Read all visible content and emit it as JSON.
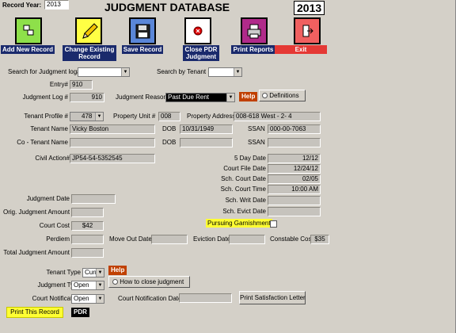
{
  "header": {
    "record_year_label": "Record Year:",
    "record_year_value": "2013",
    "title": "JUDGMENT DATABASE",
    "year_badge": "2013"
  },
  "toolbar": {
    "add_new_record": "Add New Record",
    "change_existing_record": "Change Existing Record",
    "save_record": "Save Record",
    "close_pdr_judgment": "Close PDR Judgment",
    "print_reports": "Print Reports",
    "exit": "Exit"
  },
  "search": {
    "judgment_log_label": "Search for Judgment log#",
    "judgment_log_value": "",
    "tenant_label": "Search by Tenant",
    "tenant_value": ""
  },
  "record": {
    "entry_label": "Entry#",
    "entry_value": "910",
    "judgment_log_label": "Judgment Log #",
    "judgment_log_value": "910",
    "judgment_reason_label": "Judgment Reason",
    "judgment_reason_value": "Past Due Rent",
    "help_label": "Help",
    "definitions_label": "Definitions",
    "tenant_profile_label": "Tenant Profile #",
    "tenant_profile_value": "478",
    "property_unit_label": "Property  Unit #",
    "property_unit_value": "008",
    "property_address_label": "Property  Address:",
    "property_address_value": "008-618 West  - 2- 4",
    "tenant_name_label": "Tenant Name",
    "tenant_name_value": "Vicky Boston",
    "dob_label": "DOB",
    "dob_value": "10/31/1949",
    "ssan_label": "SSAN",
    "ssan_value": "000-00-7063",
    "co_tenant_name_label": "Co - Tenant Name",
    "co_tenant_name_value": "",
    "co_dob_label": "DOB",
    "co_dob_value": "",
    "co_ssan_label": "SSAN",
    "co_ssan_value": "",
    "civil_action_label": "Civil Action#",
    "civil_action_value": "JP54-54-5352545"
  },
  "dates": {
    "five_day_label": "5 Day Date",
    "five_day_value": "12/12",
    "court_file_label": "Court File Date",
    "court_file_value": "12/24/12",
    "sch_court_date_label": "Sch. Court Date",
    "sch_court_date_value": "02/05",
    "sch_court_time_label": "Sch. Court Time",
    "sch_court_time_value": "10:00 AM",
    "sch_writ_label": "Sch. Writ Date",
    "sch_writ_value": "",
    "sch_evict_label": "Sch. Evict Date",
    "sch_evict_value": "",
    "pursuing_garnishment_label": "Pursuing Garnishment"
  },
  "amounts": {
    "judgment_date_label": "Judgment Date",
    "judgment_date_value": "",
    "orig_judgment_amount_label": "Orig. Judgment Amount",
    "orig_judgment_amount_value": "",
    "court_cost_label": "Court Cost",
    "court_cost_value": "$42",
    "perdiem_label": "Perdiem",
    "perdiem_value": "",
    "move_out_label": "Move Out Date",
    "move_out_value": "",
    "eviction_label": "Eviction Date",
    "eviction_value": "",
    "constable_cost_label": "Constable Cost",
    "constable_cost_value": "$35",
    "total_judgment_label": "Total Judgment Amount",
    "total_judgment_value": ""
  },
  "footer": {
    "tenant_type_label": "Tenant Type",
    "tenant_type_value": "Current",
    "help_label": "Help",
    "judgment_type_label": "Judgment Type",
    "judgment_type_value": "Open",
    "how_to_close_label": "How to close judgment",
    "court_notification_label": "Court Notification",
    "court_notification_value": "Open",
    "court_notification_date_label": "Court Notification Date",
    "court_notification_date_value": "",
    "print_satisfaction_letter": "Print Satisfaction Letter",
    "print_this_record": "Print This Record",
    "pdr_badge": "PDR"
  },
  "colors": {
    "background": "#d4d0c8",
    "caption_navy": "#1a2a6c",
    "exit_red": "#e53935",
    "help_orange": "#c04000",
    "highlight_yellow": "#ffff33"
  }
}
